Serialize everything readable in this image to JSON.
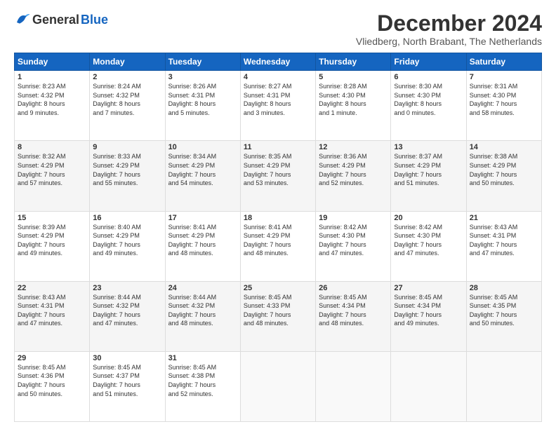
{
  "logo": {
    "general": "General",
    "blue": "Blue"
  },
  "title": "December 2024",
  "subtitle": "Vliedberg, North Brabant, The Netherlands",
  "headers": [
    "Sunday",
    "Monday",
    "Tuesday",
    "Wednesday",
    "Thursday",
    "Friday",
    "Saturday"
  ],
  "weeks": [
    [
      {
        "day": "1",
        "info": "Sunrise: 8:23 AM\nSunset: 4:32 PM\nDaylight: 8 hours\nand 9 minutes."
      },
      {
        "day": "2",
        "info": "Sunrise: 8:24 AM\nSunset: 4:32 PM\nDaylight: 8 hours\nand 7 minutes."
      },
      {
        "day": "3",
        "info": "Sunrise: 8:26 AM\nSunset: 4:31 PM\nDaylight: 8 hours\nand 5 minutes."
      },
      {
        "day": "4",
        "info": "Sunrise: 8:27 AM\nSunset: 4:31 PM\nDaylight: 8 hours\nand 3 minutes."
      },
      {
        "day": "5",
        "info": "Sunrise: 8:28 AM\nSunset: 4:30 PM\nDaylight: 8 hours\nand 1 minute."
      },
      {
        "day": "6",
        "info": "Sunrise: 8:30 AM\nSunset: 4:30 PM\nDaylight: 8 hours\nand 0 minutes."
      },
      {
        "day": "7",
        "info": "Sunrise: 8:31 AM\nSunset: 4:30 PM\nDaylight: 7 hours\nand 58 minutes."
      }
    ],
    [
      {
        "day": "8",
        "info": "Sunrise: 8:32 AM\nSunset: 4:29 PM\nDaylight: 7 hours\nand 57 minutes."
      },
      {
        "day": "9",
        "info": "Sunrise: 8:33 AM\nSunset: 4:29 PM\nDaylight: 7 hours\nand 55 minutes."
      },
      {
        "day": "10",
        "info": "Sunrise: 8:34 AM\nSunset: 4:29 PM\nDaylight: 7 hours\nand 54 minutes."
      },
      {
        "day": "11",
        "info": "Sunrise: 8:35 AM\nSunset: 4:29 PM\nDaylight: 7 hours\nand 53 minutes."
      },
      {
        "day": "12",
        "info": "Sunrise: 8:36 AM\nSunset: 4:29 PM\nDaylight: 7 hours\nand 52 minutes."
      },
      {
        "day": "13",
        "info": "Sunrise: 8:37 AM\nSunset: 4:29 PM\nDaylight: 7 hours\nand 51 minutes."
      },
      {
        "day": "14",
        "info": "Sunrise: 8:38 AM\nSunset: 4:29 PM\nDaylight: 7 hours\nand 50 minutes."
      }
    ],
    [
      {
        "day": "15",
        "info": "Sunrise: 8:39 AM\nSunset: 4:29 PM\nDaylight: 7 hours\nand 49 minutes."
      },
      {
        "day": "16",
        "info": "Sunrise: 8:40 AM\nSunset: 4:29 PM\nDaylight: 7 hours\nand 49 minutes."
      },
      {
        "day": "17",
        "info": "Sunrise: 8:41 AM\nSunset: 4:29 PM\nDaylight: 7 hours\nand 48 minutes."
      },
      {
        "day": "18",
        "info": "Sunrise: 8:41 AM\nSunset: 4:29 PM\nDaylight: 7 hours\nand 48 minutes."
      },
      {
        "day": "19",
        "info": "Sunrise: 8:42 AM\nSunset: 4:30 PM\nDaylight: 7 hours\nand 47 minutes."
      },
      {
        "day": "20",
        "info": "Sunrise: 8:42 AM\nSunset: 4:30 PM\nDaylight: 7 hours\nand 47 minutes."
      },
      {
        "day": "21",
        "info": "Sunrise: 8:43 AM\nSunset: 4:31 PM\nDaylight: 7 hours\nand 47 minutes."
      }
    ],
    [
      {
        "day": "22",
        "info": "Sunrise: 8:43 AM\nSunset: 4:31 PM\nDaylight: 7 hours\nand 47 minutes."
      },
      {
        "day": "23",
        "info": "Sunrise: 8:44 AM\nSunset: 4:32 PM\nDaylight: 7 hours\nand 47 minutes."
      },
      {
        "day": "24",
        "info": "Sunrise: 8:44 AM\nSunset: 4:32 PM\nDaylight: 7 hours\nand 48 minutes."
      },
      {
        "day": "25",
        "info": "Sunrise: 8:45 AM\nSunset: 4:33 PM\nDaylight: 7 hours\nand 48 minutes."
      },
      {
        "day": "26",
        "info": "Sunrise: 8:45 AM\nSunset: 4:34 PM\nDaylight: 7 hours\nand 48 minutes."
      },
      {
        "day": "27",
        "info": "Sunrise: 8:45 AM\nSunset: 4:34 PM\nDaylight: 7 hours\nand 49 minutes."
      },
      {
        "day": "28",
        "info": "Sunrise: 8:45 AM\nSunset: 4:35 PM\nDaylight: 7 hours\nand 50 minutes."
      }
    ],
    [
      {
        "day": "29",
        "info": "Sunrise: 8:45 AM\nSunset: 4:36 PM\nDaylight: 7 hours\nand 50 minutes."
      },
      {
        "day": "30",
        "info": "Sunrise: 8:45 AM\nSunset: 4:37 PM\nDaylight: 7 hours\nand 51 minutes."
      },
      {
        "day": "31",
        "info": "Sunrise: 8:45 AM\nSunset: 4:38 PM\nDaylight: 7 hours\nand 52 minutes."
      },
      {
        "day": "",
        "info": ""
      },
      {
        "day": "",
        "info": ""
      },
      {
        "day": "",
        "info": ""
      },
      {
        "day": "",
        "info": ""
      }
    ]
  ]
}
